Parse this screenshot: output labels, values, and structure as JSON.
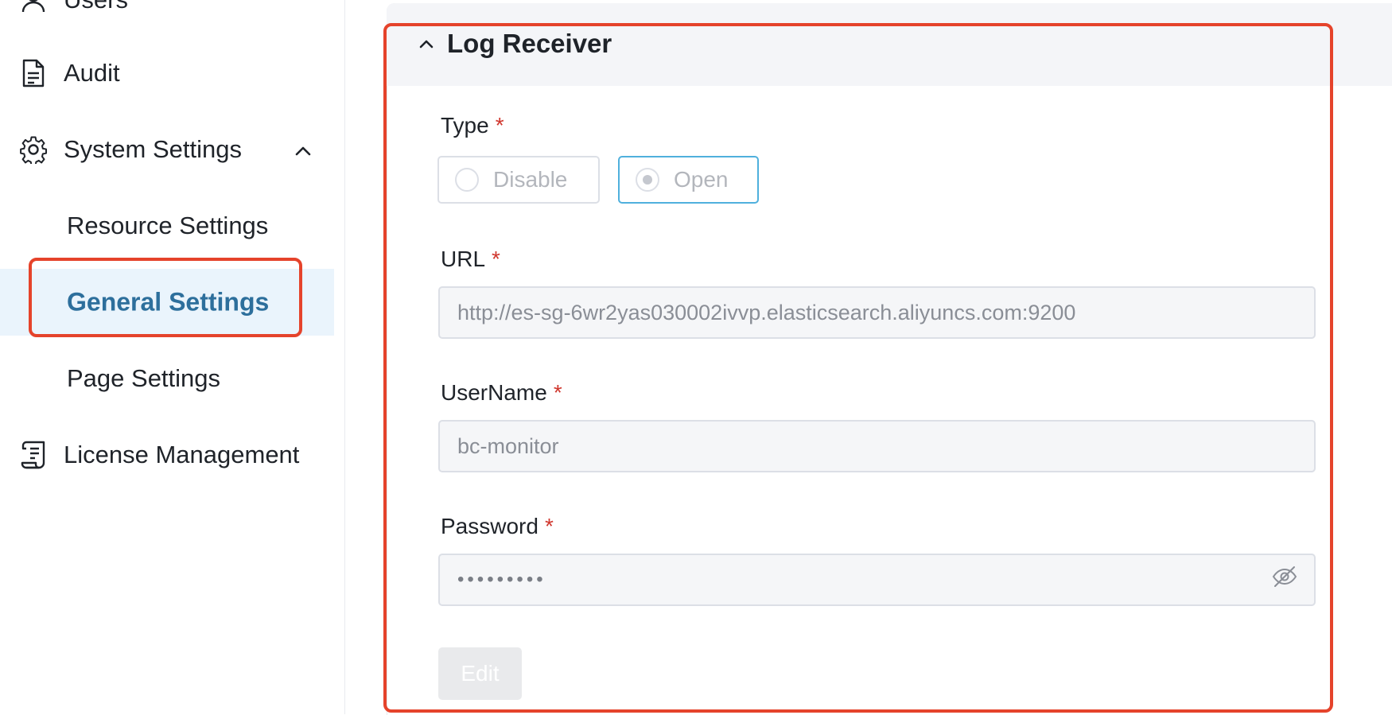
{
  "sidebar": {
    "items": [
      {
        "label": "Users",
        "icon": "user-icon"
      },
      {
        "label": "Audit",
        "icon": "document-icon"
      },
      {
        "label": "System Settings",
        "icon": "gear-icon",
        "expanded": true
      },
      {
        "label": "Resource Settings"
      },
      {
        "label": "General Settings",
        "active": true
      },
      {
        "label": "Page Settings"
      },
      {
        "label": "License Management",
        "icon": "license-icon"
      }
    ]
  },
  "panel": {
    "title": "Log Receiver",
    "type": {
      "label": "Type",
      "required_mark": "*",
      "options": [
        "Disable",
        "Open"
      ],
      "selected": "Open"
    },
    "url": {
      "label": "URL",
      "required_mark": "*",
      "value": "http://es-sg-6wr2yas030002ivvp.elasticsearch.aliyuncs.com:9200"
    },
    "username": {
      "label": "UserName",
      "required_mark": "*",
      "value": "bc-monitor"
    },
    "password": {
      "label": "Password",
      "required_mark": "*",
      "value": "•••••••••"
    },
    "edit_label": "Edit"
  },
  "colors": {
    "accent": "#2d6f9c",
    "highlight": "#e5432b",
    "selected_border": "#4fb0dd",
    "required": "#d0362d"
  }
}
